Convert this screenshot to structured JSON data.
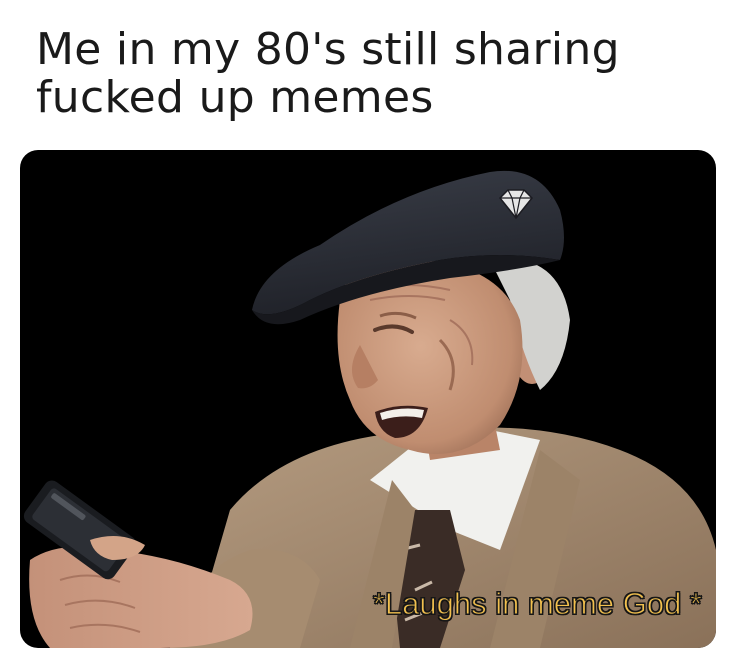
{
  "meme": {
    "caption_line_1": "Me in my 80's still sharing",
    "caption_line_2": "fucked up memes",
    "subtitle": "*Laughs in meme God *",
    "colors": {
      "background": "#ffffff",
      "caption_text": "#1a1a1a",
      "photo_background": "#000000",
      "subtitle_fill": "#f2c04e",
      "subtitle_outline": "#1b1b1b",
      "cap": "#2b2e36",
      "cardigan": "#a68c70",
      "skin": "#c99a7e",
      "shirt": "#f1f1ee",
      "tie": "#3a2c26"
    }
  }
}
